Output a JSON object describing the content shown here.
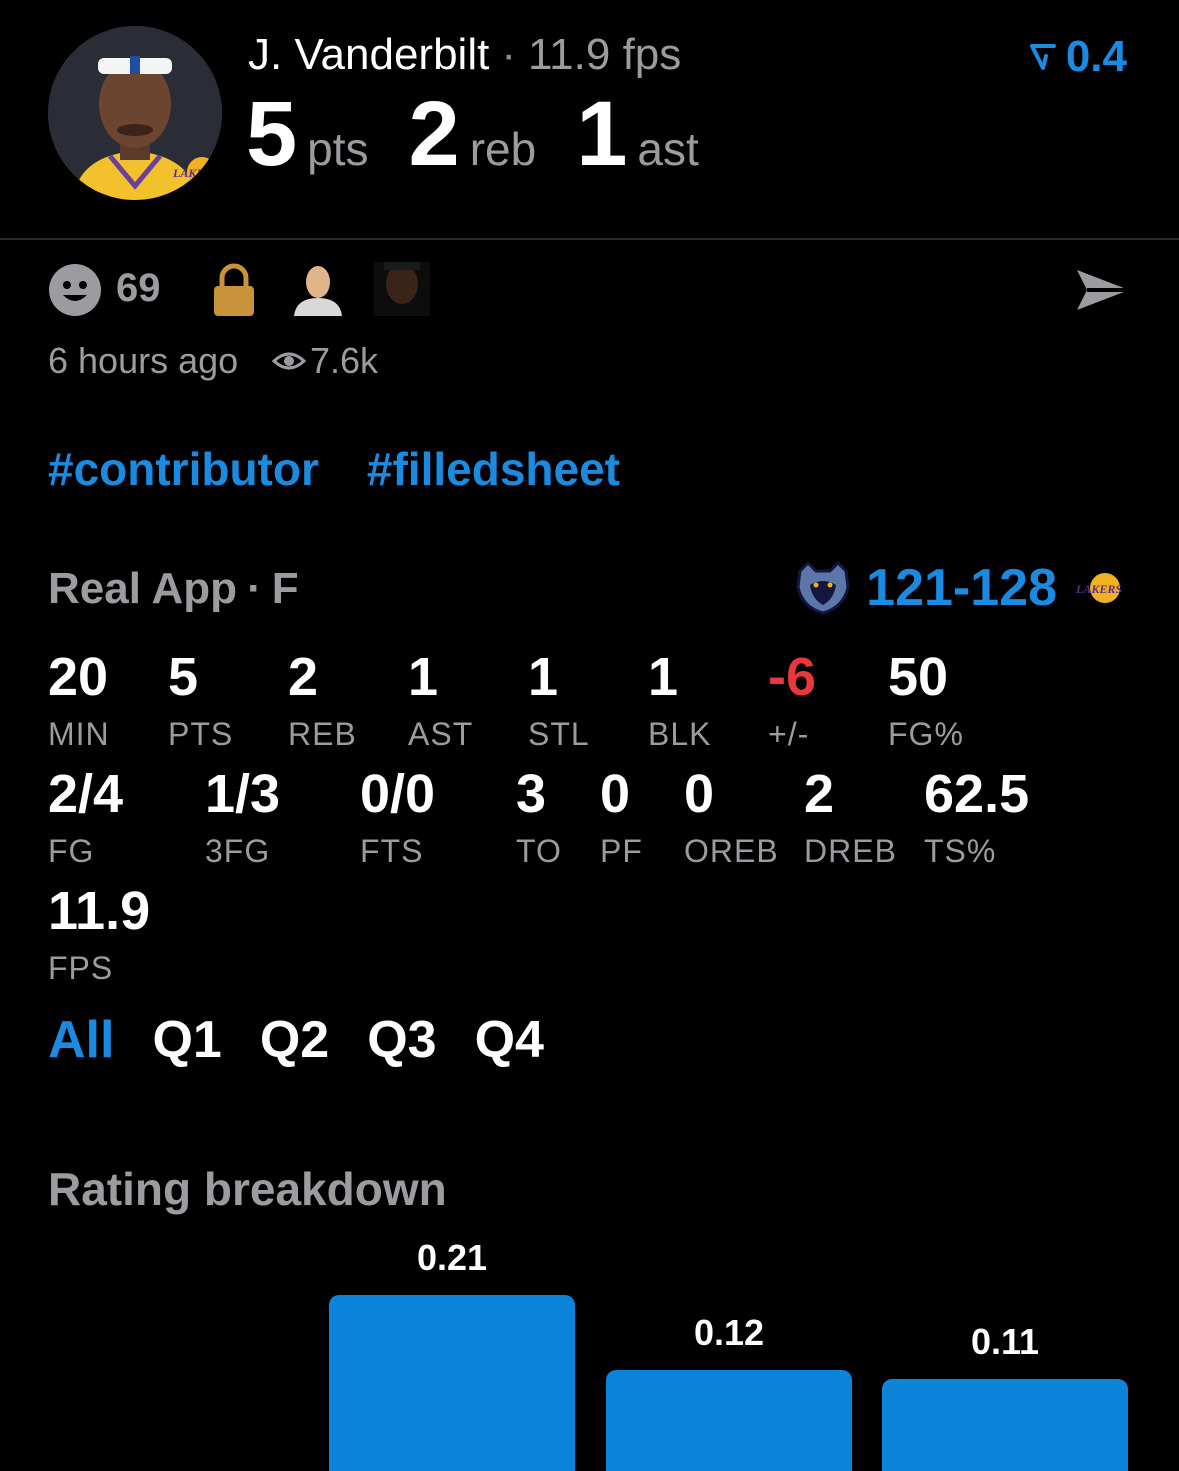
{
  "header": {
    "player_name": "J. Vanderbilt",
    "fps_text": "11.9 fps",
    "trend_value": "0.4",
    "team_logo_text": "LAKERS",
    "stats": [
      {
        "value": "5",
        "unit": "pts"
      },
      {
        "value": "2",
        "unit": "reb"
      },
      {
        "value": "1",
        "unit": "ast"
      }
    ]
  },
  "social": {
    "likes": "69",
    "time_ago": "6 hours ago",
    "views": "7.6k"
  },
  "tags": [
    "#contributor",
    "#filledsheet"
  ],
  "game": {
    "source": "Real App",
    "status": "F",
    "score": "121-128"
  },
  "box_row1": [
    {
      "value": "20",
      "label": "MIN"
    },
    {
      "value": "5",
      "label": "PTS"
    },
    {
      "value": "2",
      "label": "REB"
    },
    {
      "value": "1",
      "label": "AST"
    },
    {
      "value": "1",
      "label": "STL"
    },
    {
      "value": "1",
      "label": "BLK"
    },
    {
      "value": "-6",
      "label": "+/-"
    },
    {
      "value": "50",
      "label": "FG%"
    }
  ],
  "box_row2": [
    {
      "value": "2/4",
      "label": "FG"
    },
    {
      "value": "1/3",
      "label": "3FG"
    },
    {
      "value": "0/0",
      "label": "FTS"
    },
    {
      "value": "3",
      "label": "TO"
    },
    {
      "value": "0",
      "label": "PF"
    },
    {
      "value": "0",
      "label": "OREB"
    },
    {
      "value": "2",
      "label": "DREB"
    },
    {
      "value": "62.5",
      "label": "TS%"
    }
  ],
  "box_row3": [
    {
      "value": "11.9",
      "label": "FPS"
    }
  ],
  "quarter_tabs": [
    "All",
    "Q1",
    "Q2",
    "Q3",
    "Q4"
  ],
  "active_tab": "All",
  "rating": {
    "title": "Rating breakdown"
  },
  "chart_data": {
    "type": "bar",
    "values": [
      0.21,
      0.12,
      0.11
    ],
    "labels": [
      "0.21",
      "0.12",
      "0.11"
    ],
    "ylim": [
      0,
      0.25
    ]
  },
  "colors": {
    "accent": "#1a8be0",
    "bar": "#0b84d9",
    "negative": "#e8383d",
    "muted": "#9b9ba0",
    "background": "#000000"
  }
}
